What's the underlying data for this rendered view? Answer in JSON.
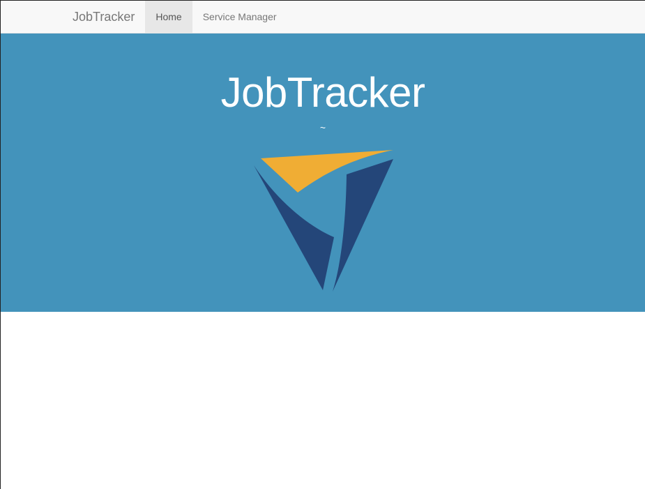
{
  "navbar": {
    "brand": "JobTracker",
    "items": [
      {
        "label": "Home",
        "active": true
      },
      {
        "label": "Service Manager",
        "active": false
      }
    ]
  },
  "hero": {
    "title": "JobTracker",
    "subtitle": "~",
    "logo_icon": "jobtracker-logo-icon"
  },
  "colors": {
    "hero_background": "#4393bb",
    "logo_gold": "#f0ad34",
    "logo_navy": "#244679",
    "navbar_background": "#f8f8f8",
    "active_tab_background": "#e7e7e7"
  }
}
